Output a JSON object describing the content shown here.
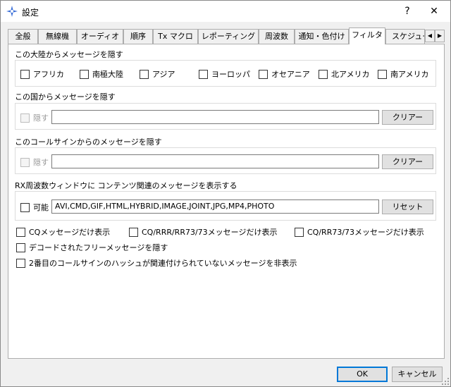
{
  "window": {
    "title": "設定"
  },
  "titlebar": {
    "help_label": "?",
    "close_label": "✕"
  },
  "tabs": [
    {
      "label": "全般"
    },
    {
      "label": "無線機"
    },
    {
      "label": "オーディオ"
    },
    {
      "label": "順序"
    },
    {
      "label": "Tx マクロ"
    },
    {
      "label": "レポーティング"
    },
    {
      "label": "周波数"
    },
    {
      "label": "通知・色付け"
    },
    {
      "label": "フィルタ",
      "active": true
    },
    {
      "label": "スケジューラ"
    }
  ],
  "continents": {
    "heading": "この大陸からメッセージを隠す",
    "items": [
      {
        "label": "アフリカ",
        "checked": false
      },
      {
        "label": "南極大陸",
        "checked": false
      },
      {
        "label": "アジア",
        "checked": false
      },
      {
        "label": "ヨーロッパ",
        "checked": false
      },
      {
        "label": "オセアニア",
        "checked": false
      },
      {
        "label": "北アメリカ",
        "checked": false
      },
      {
        "label": "南アメリカ",
        "checked": false
      }
    ]
  },
  "countries": {
    "heading": "この国からメッセージを隠す",
    "hide_label": "隠す",
    "value": "",
    "clear_label": "クリアー"
  },
  "callsigns": {
    "heading": "このコールサインからのメッセージを隠す",
    "hide_label": "隠す",
    "value": "",
    "clear_label": "クリアー"
  },
  "rx_content": {
    "heading": "RX周波数ウィンドウに コンテンツ関連のメッセージを表示する",
    "enable_label": "可能",
    "value": "AVI,CMD,GIF,HTML,HYBRID,IMAGE,JOINT,JPG,MP4,PHOTO",
    "reset_label": "リセット"
  },
  "options": {
    "cq_only": "CQメッセージだけ表示",
    "cq_rrr_only": "CQ/RRR/RR73/73メッセージだけ表示",
    "cq_rr73_only": "CQ/RR73/73メッセージだけ表示",
    "hide_free": "デコードされたフリーメッセージを隠す",
    "hide_unhashed": "2番目のコールサインのハッシュが関連付けられていないメッセージを非表示"
  },
  "footer": {
    "ok_label": "OK",
    "cancel_label": "キャンセル"
  }
}
